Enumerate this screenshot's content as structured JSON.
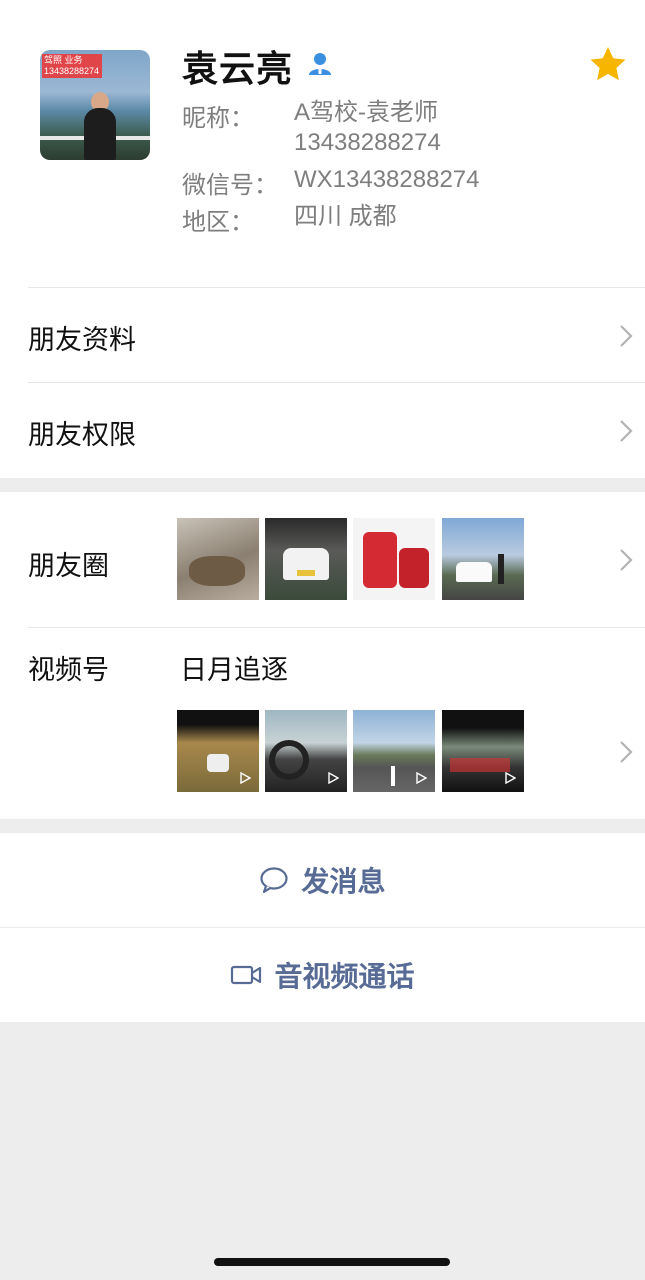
{
  "profile": {
    "name": "袁云亮",
    "avatar_tag_line1": "驾照  业务",
    "avatar_tag_line2": "13438288274",
    "nickname_label": "昵称：",
    "nickname_line1": "A驾校-袁老师",
    "nickname_line2": "13438288274",
    "wechat_label": "微信号：",
    "wechat_value": "WX13438288274",
    "region_label": "地区：",
    "region_value": "四川 成都",
    "star_color": "#f7b500",
    "person_icon_color": "#3b8fe0"
  },
  "menu": {
    "friend_info": "朋友资料",
    "friend_permissions": "朋友权限"
  },
  "moments": {
    "label": "朋友圈",
    "channel_label": "视频号",
    "channel_name": "日月追逐"
  },
  "actions": {
    "message": "发消息",
    "call": "音视频通话",
    "accent_color": "#576b95"
  }
}
